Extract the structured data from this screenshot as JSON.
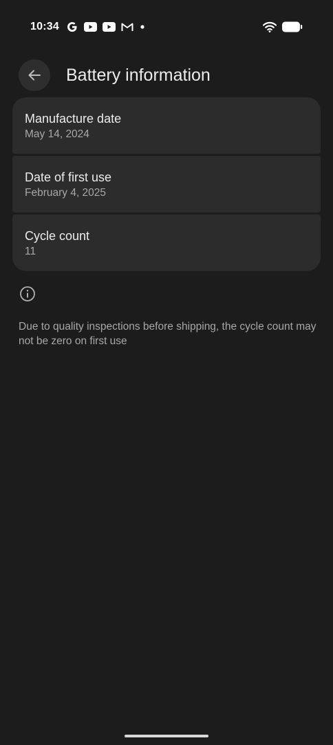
{
  "status_bar": {
    "time": "10:34",
    "notification_icons": [
      "google-icon",
      "youtube-icon",
      "youtube-icon",
      "gmail-icon",
      "dot-icon"
    ],
    "system_icons": [
      "wifi-icon",
      "battery-icon"
    ]
  },
  "header": {
    "back_icon": "arrow-left-icon",
    "title": "Battery information"
  },
  "cards": [
    {
      "title": "Manufacture date",
      "value": "May 14, 2024"
    },
    {
      "title": "Date of first use",
      "value": "February 4, 2025"
    },
    {
      "title": "Cycle count",
      "value": "11"
    }
  ],
  "info": {
    "icon": "info-icon",
    "text": "Due to quality inspections before shipping, the cycle count may not be zero on first use"
  },
  "colors": {
    "background": "#1c1c1c",
    "card": "#2c2c2c",
    "primary_text": "#ececec",
    "secondary_text": "#a8a8a8"
  }
}
